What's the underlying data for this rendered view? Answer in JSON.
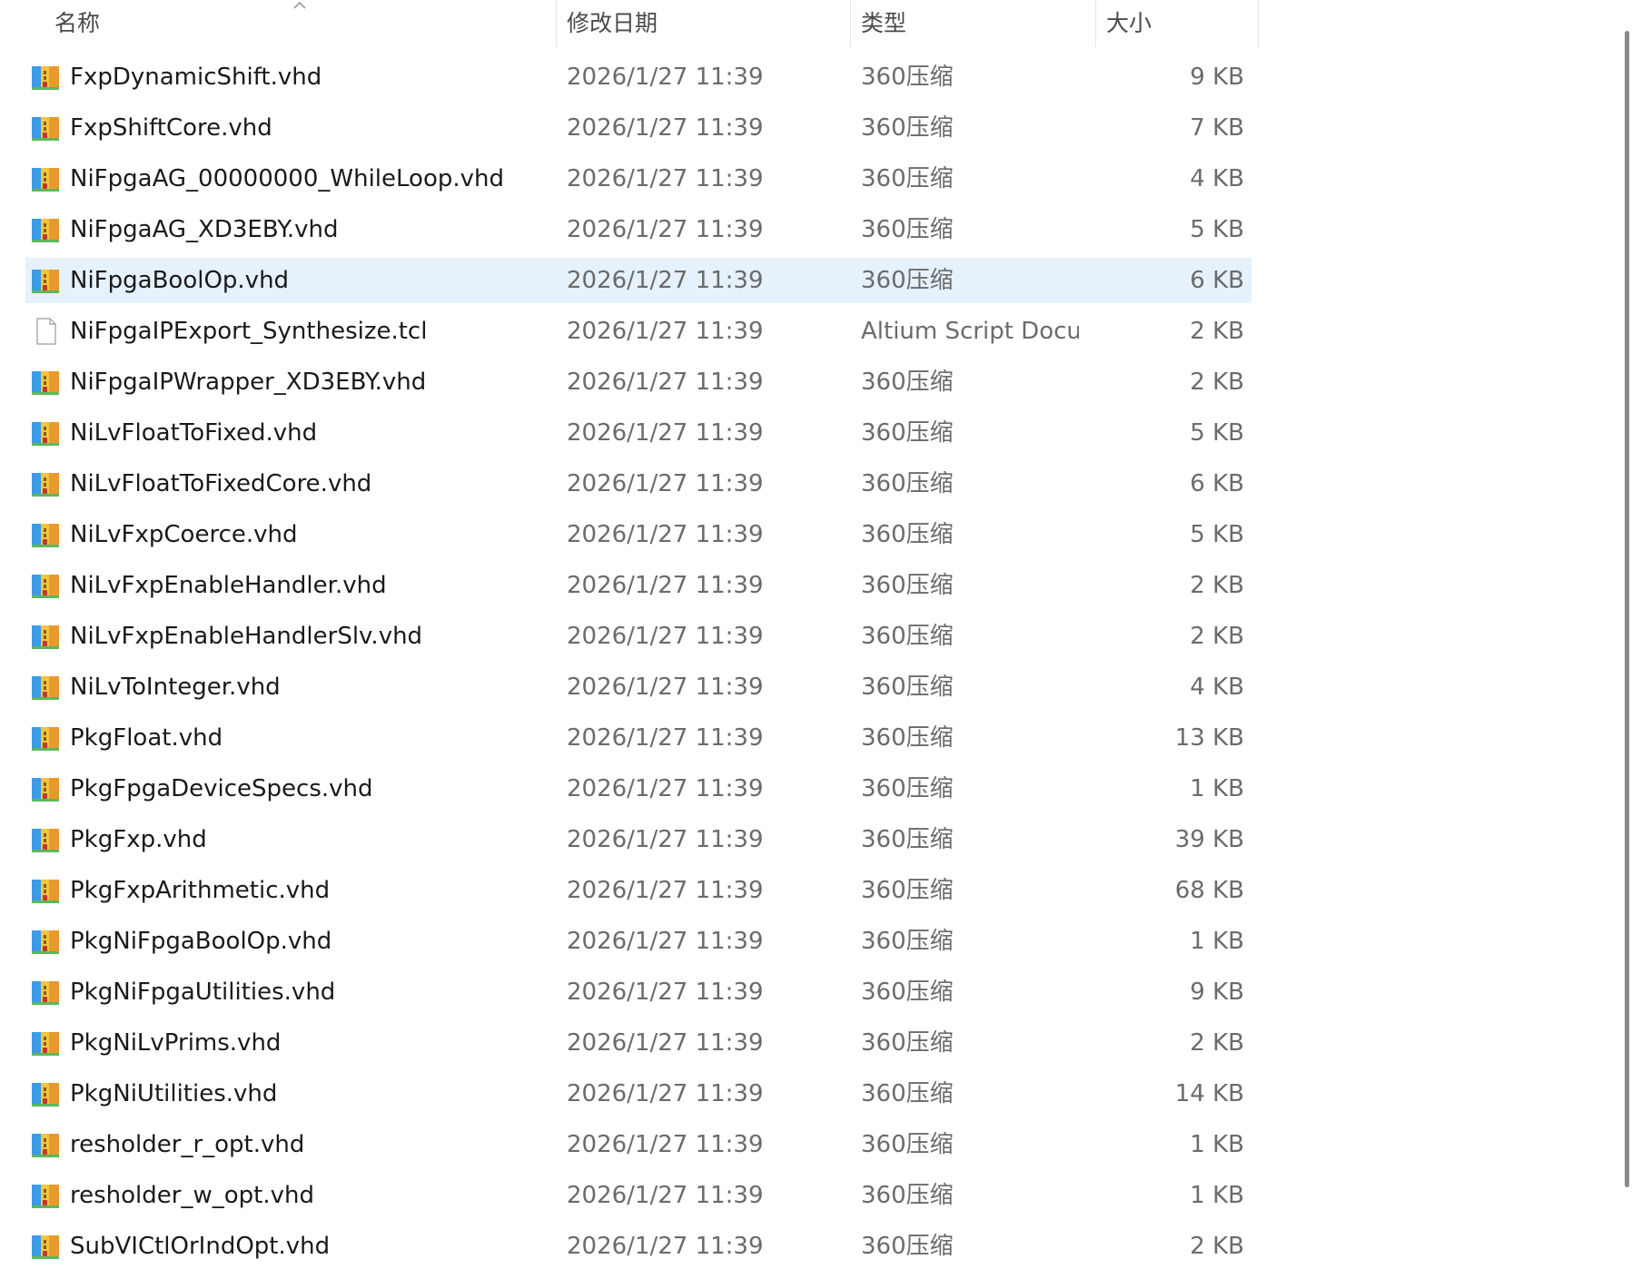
{
  "columns": {
    "name": "名称",
    "modified": "修改日期",
    "type": "类型",
    "size": "大小"
  },
  "selected_index": 4,
  "files": [
    {
      "name": "FxpDynamicShift.vhd",
      "modified": "2026/1/27 11:39",
      "type": "360压缩",
      "size": "9 KB",
      "icon": "archive-icon"
    },
    {
      "name": "FxpShiftCore.vhd",
      "modified": "2026/1/27 11:39",
      "type": "360压缩",
      "size": "7 KB",
      "icon": "archive-icon"
    },
    {
      "name": "NiFpgaAG_00000000_WhileLoop.vhd",
      "modified": "2026/1/27 11:39",
      "type": "360压缩",
      "size": "4 KB",
      "icon": "archive-icon"
    },
    {
      "name": "NiFpgaAG_XD3EBY.vhd",
      "modified": "2026/1/27 11:39",
      "type": "360压缩",
      "size": "5 KB",
      "icon": "archive-icon"
    },
    {
      "name": "NiFpgaBoolOp.vhd",
      "modified": "2026/1/27 11:39",
      "type": "360压缩",
      "size": "6 KB",
      "icon": "archive-icon"
    },
    {
      "name": "NiFpgaIPExport_Synthesize.tcl",
      "modified": "2026/1/27 11:39",
      "type": "Altium Script Docu...",
      "size": "2 KB",
      "icon": "document-icon"
    },
    {
      "name": "NiFpgaIPWrapper_XD3EBY.vhd",
      "modified": "2026/1/27 11:39",
      "type": "360压缩",
      "size": "2 KB",
      "icon": "archive-icon"
    },
    {
      "name": "NiLvFloatToFixed.vhd",
      "modified": "2026/1/27 11:39",
      "type": "360压缩",
      "size": "5 KB",
      "icon": "archive-icon"
    },
    {
      "name": "NiLvFloatToFixedCore.vhd",
      "modified": "2026/1/27 11:39",
      "type": "360压缩",
      "size": "6 KB",
      "icon": "archive-icon"
    },
    {
      "name": "NiLvFxpCoerce.vhd",
      "modified": "2026/1/27 11:39",
      "type": "360压缩",
      "size": "5 KB",
      "icon": "archive-icon"
    },
    {
      "name": "NiLvFxpEnableHandler.vhd",
      "modified": "2026/1/27 11:39",
      "type": "360压缩",
      "size": "2 KB",
      "icon": "archive-icon"
    },
    {
      "name": "NiLvFxpEnableHandlerSlv.vhd",
      "modified": "2026/1/27 11:39",
      "type": "360压缩",
      "size": "2 KB",
      "icon": "archive-icon"
    },
    {
      "name": "NiLvToInteger.vhd",
      "modified": "2026/1/27 11:39",
      "type": "360压缩",
      "size": "4 KB",
      "icon": "archive-icon"
    },
    {
      "name": "PkgFloat.vhd",
      "modified": "2026/1/27 11:39",
      "type": "360压缩",
      "size": "13 KB",
      "icon": "archive-icon"
    },
    {
      "name": "PkgFpgaDeviceSpecs.vhd",
      "modified": "2026/1/27 11:39",
      "type": "360压缩",
      "size": "1 KB",
      "icon": "archive-icon"
    },
    {
      "name": "PkgFxp.vhd",
      "modified": "2026/1/27 11:39",
      "type": "360压缩",
      "size": "39 KB",
      "icon": "archive-icon"
    },
    {
      "name": "PkgFxpArithmetic.vhd",
      "modified": "2026/1/27 11:39",
      "type": "360压缩",
      "size": "68 KB",
      "icon": "archive-icon"
    },
    {
      "name": "PkgNiFpgaBoolOp.vhd",
      "modified": "2026/1/27 11:39",
      "type": "360压缩",
      "size": "1 KB",
      "icon": "archive-icon"
    },
    {
      "name": "PkgNiFpgaUtilities.vhd",
      "modified": "2026/1/27 11:39",
      "type": "360压缩",
      "size": "9 KB",
      "icon": "archive-icon"
    },
    {
      "name": "PkgNiLvPrims.vhd",
      "modified": "2026/1/27 11:39",
      "type": "360压缩",
      "size": "2 KB",
      "icon": "archive-icon"
    },
    {
      "name": "PkgNiUtilities.vhd",
      "modified": "2026/1/27 11:39",
      "type": "360压缩",
      "size": "14 KB",
      "icon": "archive-icon"
    },
    {
      "name": "resholder_r_opt.vhd",
      "modified": "2026/1/27 11:39",
      "type": "360压缩",
      "size": "1 KB",
      "icon": "archive-icon"
    },
    {
      "name": "resholder_w_opt.vhd",
      "modified": "2026/1/27 11:39",
      "type": "360压缩",
      "size": "1 KB",
      "icon": "archive-icon"
    },
    {
      "name": "SubVICtlOrIndOpt.vhd",
      "modified": "2026/1/27 11:39",
      "type": "360压缩",
      "size": "2 KB",
      "icon": "archive-icon"
    }
  ],
  "colors": {
    "selection": "#e5f1fb",
    "header_text": "#4a4a4a",
    "meta_text": "#6b6b6b"
  }
}
